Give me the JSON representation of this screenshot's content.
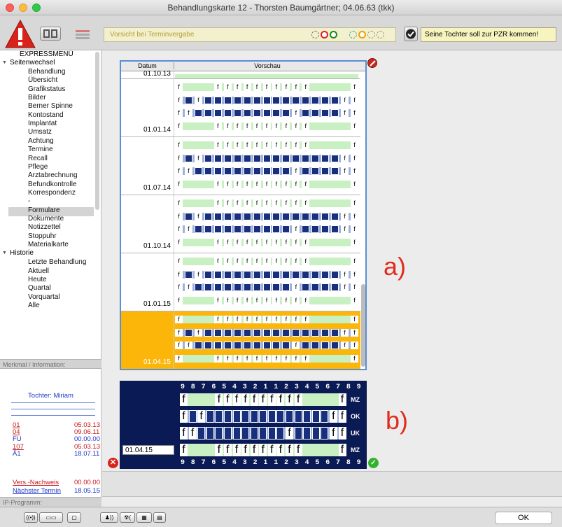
{
  "window": {
    "title": "Behandlungskarte 12 - Thorsten Baumgärtner; 04.06.63 (tkk)"
  },
  "toolbar": {
    "warning_text": "Vorsicht bei Terminvergabe",
    "note_text": "Seine Tochter soll zur PZR kommen!"
  },
  "sidebar": {
    "express": "EXPRESSMENÜ",
    "group1": "Seitenwechsel",
    "items1": [
      "Behandlung",
      "Übersicht",
      "Grafikstatus",
      "Bilder",
      "Berner Spinne",
      "Kontostand",
      "Implantat",
      "Umsatz",
      "Achtung",
      "Termine",
      "Recall",
      "Pflege",
      "Arztabrechnung",
      "Befundkontrolle",
      "Korrespondenz",
      "-",
      "Formulare",
      "Dokumente",
      "Notizzettel",
      "Stoppuhr",
      "Materialkarte"
    ],
    "group2": "Historie",
    "items2": [
      "Letzte Behandlung",
      "Aktuell",
      "Heute",
      "Quartal",
      "Vorquartal",
      "Alle"
    ]
  },
  "info": {
    "header": "Merkmal / Information:",
    "tochter": "Tochter: Miriam",
    "rows": [
      {
        "k": "01",
        "v": "05.03.13",
        "red": true
      },
      {
        "k": "04",
        "v": "09.06.11",
        "red": true
      },
      {
        "k": "FU",
        "v": "00.00.00",
        "red": false
      },
      {
        "k": "107",
        "v": "05.03.13",
        "red": true
      },
      {
        "k": "Ä1",
        "v": "18.07.11",
        "red": false
      }
    ],
    "vers_k": "Vers.-Nachweis",
    "vers_v": "00.00.00",
    "next_k": "Nächster Termin",
    "next_v": "18.05.15",
    "ip": "IP-Programm:"
  },
  "list": {
    "col_datum": "Datum",
    "col_vorschau": "Vorschau",
    "top_date": "01.10.13",
    "dates": [
      "01.01.14",
      "01.07.14",
      "01.10.14",
      "01.01.15",
      "01.04.15"
    ]
  },
  "labels": {
    "a": "a)",
    "b": "b)"
  },
  "schema": {
    "numbers": "9 8 7 6 5 4 3 2 1   1 2 3 4 5 6 7 8 9",
    "row_labels": [
      "MZ",
      "OK",
      "UK",
      "MZ"
    ],
    "date": "01.04.15"
  },
  "cell_glyph": "f",
  "bottom": {
    "ok": "OK"
  }
}
